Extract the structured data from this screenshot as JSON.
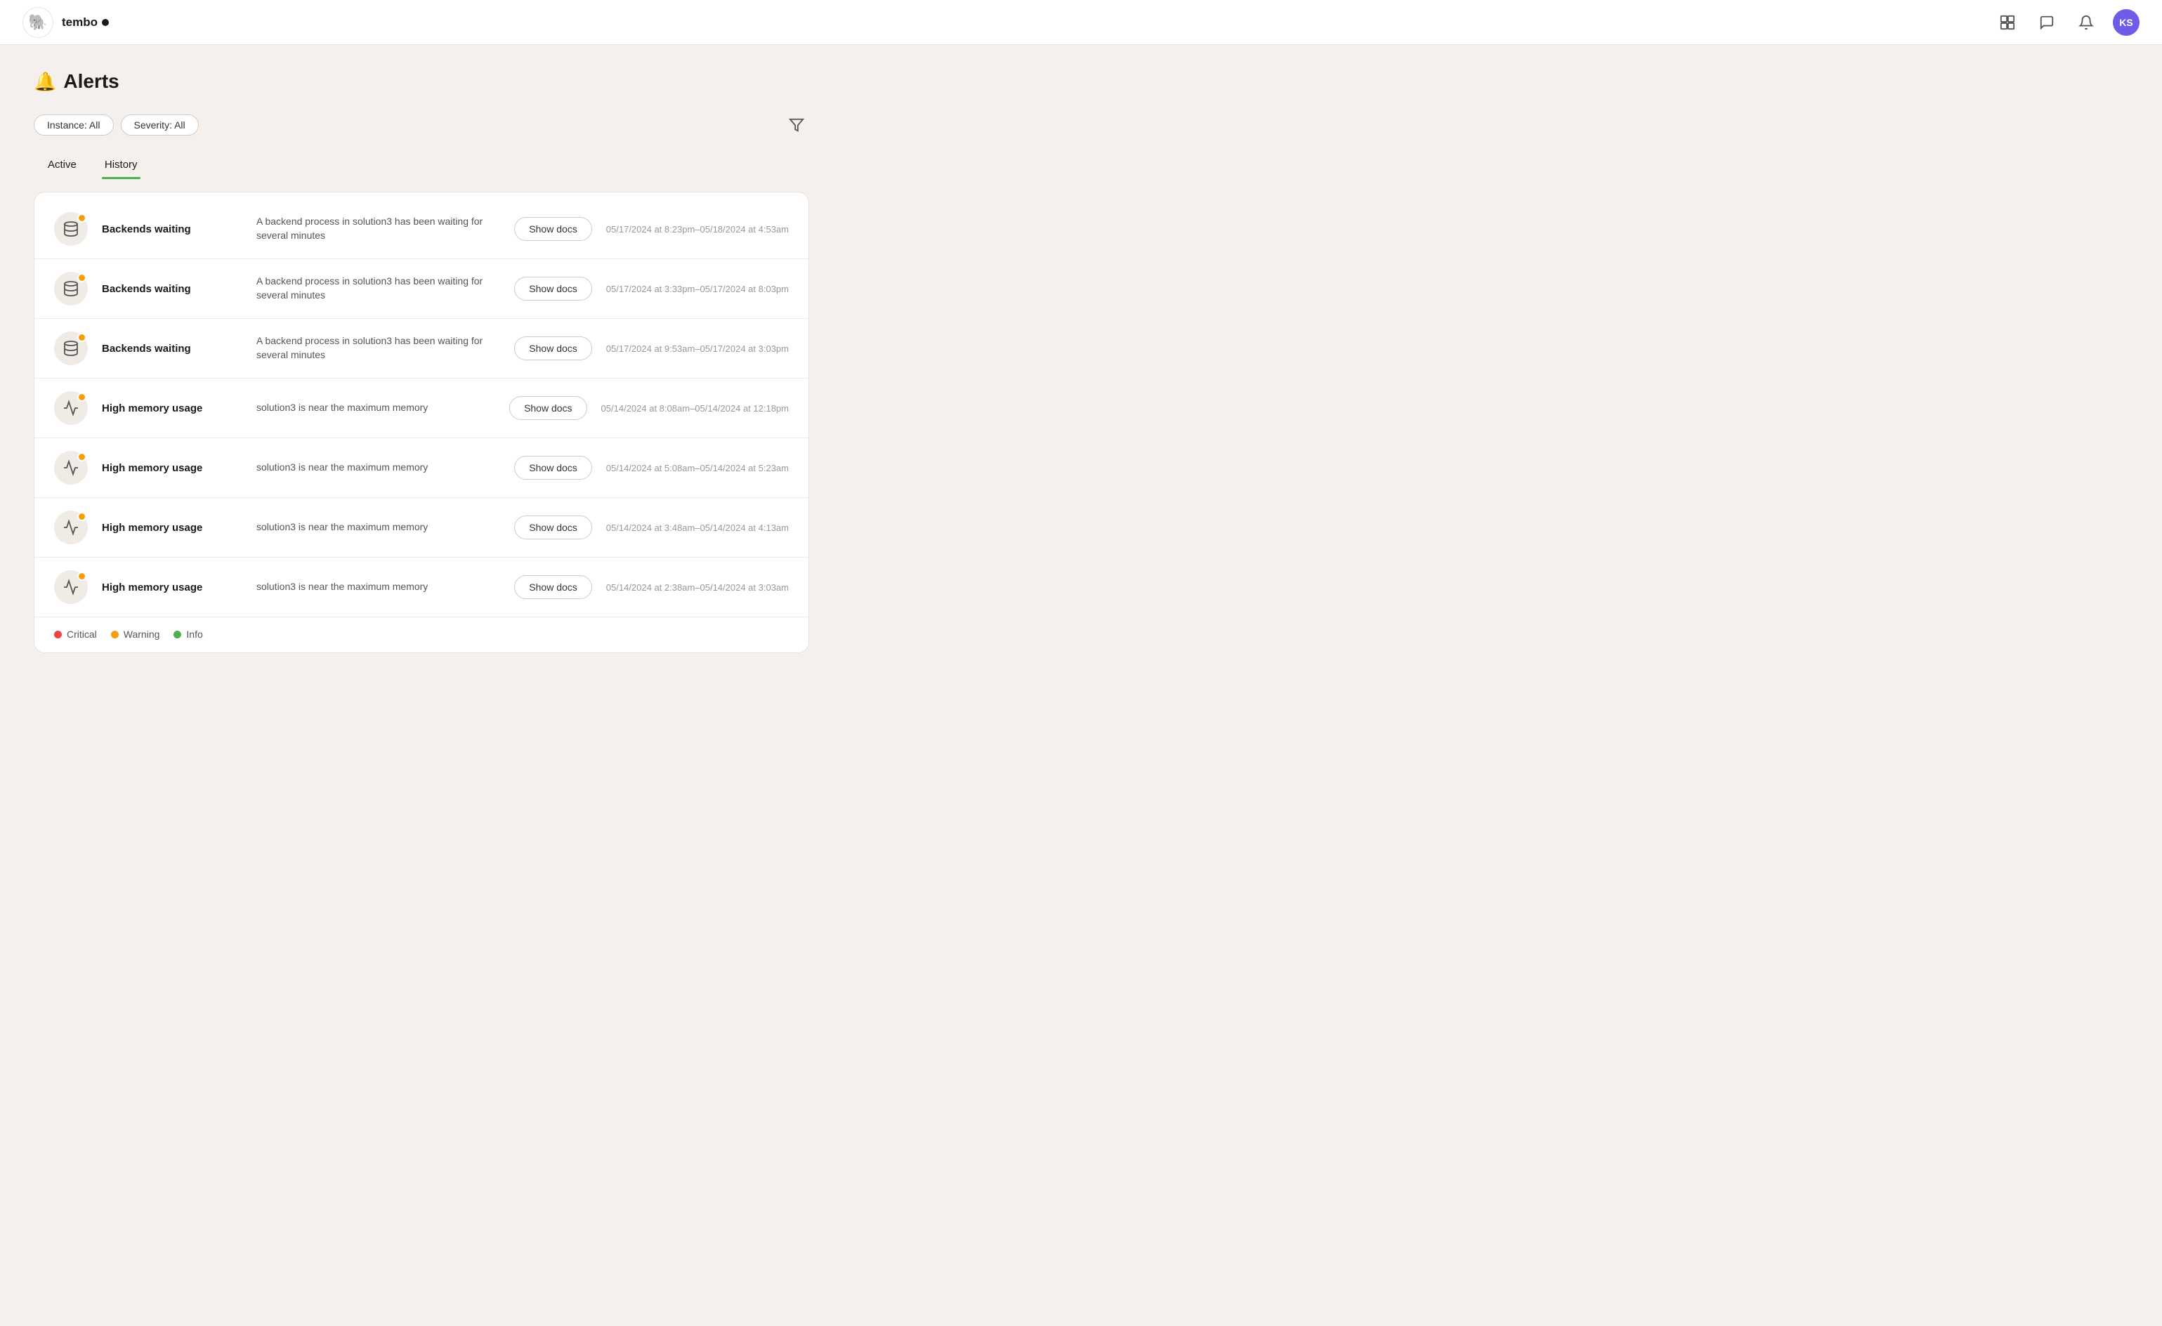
{
  "brand": {
    "name": "tembo",
    "logo_emoji": "🐘"
  },
  "navbar": {
    "avatar_initials": "KS"
  },
  "page": {
    "title": "Alerts",
    "filters": {
      "instance_label": "Instance: All",
      "severity_label": "Severity: All"
    },
    "tabs": [
      {
        "id": "active",
        "label": "Active"
      },
      {
        "id": "history",
        "label": "History",
        "active": true
      }
    ]
  },
  "alerts": [
    {
      "name": "Backends waiting",
      "description": "A backend process in solution3 has been waiting for several minutes",
      "time": "05/17/2024 at 8:23pm–05/18/2024 at 4:53am",
      "severity": "warning",
      "icon": "database"
    },
    {
      "name": "Backends waiting",
      "description": "A backend process in solution3 has been waiting for several minutes",
      "time": "05/17/2024 at 3:33pm–05/17/2024 at 8:03pm",
      "severity": "warning",
      "icon": "database"
    },
    {
      "name": "Backends waiting",
      "description": "A backend process in solution3 has been waiting for several minutes",
      "time": "05/17/2024 at 9:53am–05/17/2024 at 3:03pm",
      "severity": "warning",
      "icon": "database"
    },
    {
      "name": "High memory usage",
      "description": "solution3 is near the maximum memory",
      "time": "05/14/2024 at 8:08am–05/14/2024 at 12:18pm",
      "severity": "warning",
      "icon": "chart"
    },
    {
      "name": "High memory usage",
      "description": "solution3 is near the maximum memory",
      "time": "05/14/2024 at 5:08am–05/14/2024 at 5:23am",
      "severity": "warning",
      "icon": "chart"
    },
    {
      "name": "High memory usage",
      "description": "solution3 is near the maximum memory",
      "time": "05/14/2024 at 3:48am–05/14/2024 at 4:13am",
      "severity": "warning",
      "icon": "chart"
    },
    {
      "name": "High memory usage",
      "description": "solution3 is near the maximum memory",
      "time": "05/14/2024 at 2:38am–05/14/2024 at 3:03am",
      "severity": "warning",
      "icon": "chart"
    }
  ],
  "show_docs_label": "Show docs",
  "legend": {
    "critical_label": "Critical",
    "warning_label": "Warning",
    "info_label": "Info"
  }
}
